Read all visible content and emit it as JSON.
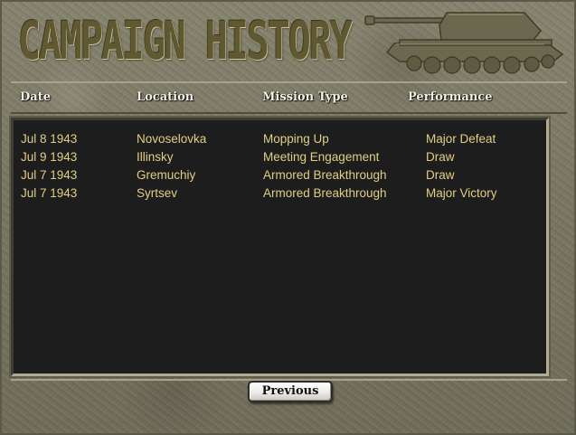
{
  "title": "CAMPAIGN HISTORY",
  "columns": {
    "date": "Date",
    "location": "Location",
    "mission_type": "Mission Type",
    "performance": "Performance"
  },
  "rows": [
    {
      "date": "Jul 8 1943",
      "location": "Novoselovka",
      "mission_type": "Mopping Up",
      "performance": "Major Defeat"
    },
    {
      "date": "Jul 9 1943",
      "location": "Illinsky",
      "mission_type": "Meeting Engagement",
      "performance": "Draw"
    },
    {
      "date": "Jul 7 1943",
      "location": "Gremuchiy",
      "mission_type": "Armored Breakthrough",
      "performance": "Draw"
    },
    {
      "date": "Jul 7 1943",
      "location": "Syrtsev",
      "mission_type": "Armored Breakthrough",
      "performance": "Major Victory"
    }
  ],
  "buttons": {
    "previous": "Previous"
  },
  "icons": {
    "tank": "tank-icon"
  },
  "colors": {
    "background": "#7d7a66",
    "title": "#5f5830",
    "list_background": "#1d1d1d",
    "list_text": "#e0cf85",
    "header_text": "#f3f0e4"
  }
}
